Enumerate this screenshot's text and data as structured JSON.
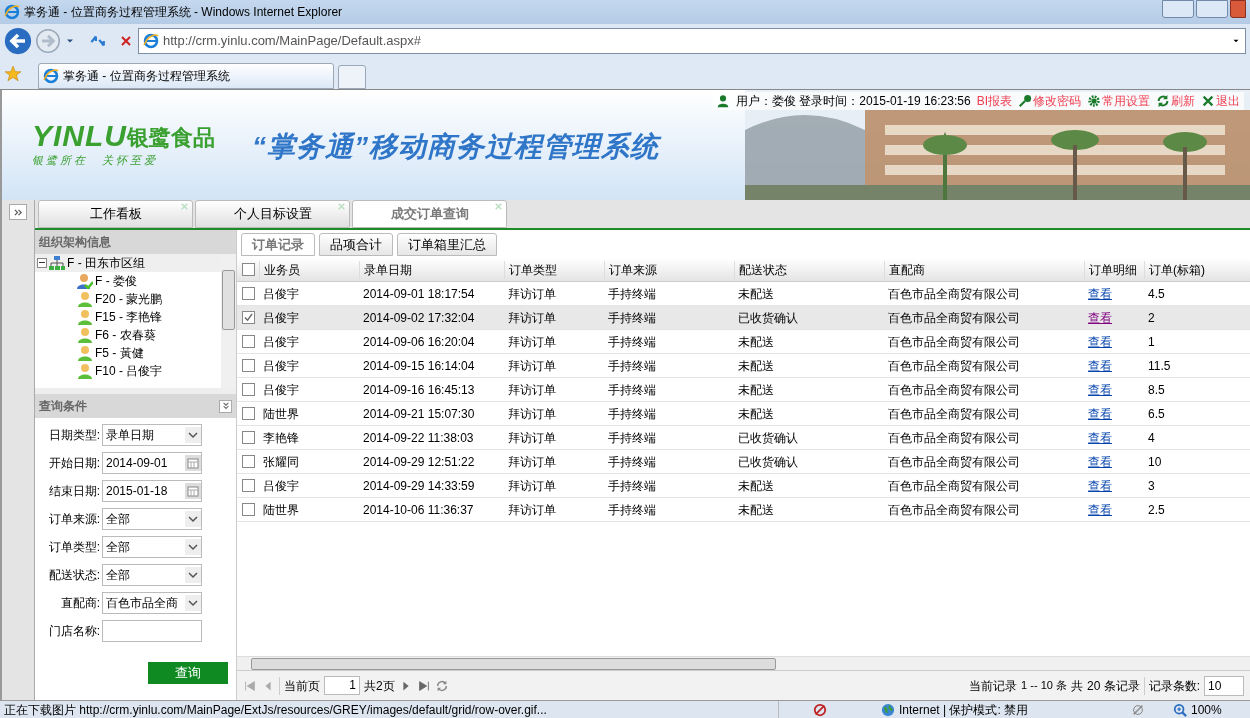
{
  "window": {
    "title": "掌务通 - 位置商务过程管理系统 - Windows Internet Explorer"
  },
  "address": {
    "url": "http://crm.yinlu.com/MainPage/Default.aspx#"
  },
  "browser_tabs": [
    {
      "label": "掌务通 - 位置商务过程管理系统",
      "selected": true
    }
  ],
  "header": {
    "user": "用户：娄俊 登录时间：2015-01-19 16:23:56",
    "links": [
      {
        "label": "BI报表",
        "kind": "none"
      },
      {
        "label": "修改密码",
        "kind": "key"
      },
      {
        "label": "常用设置",
        "kind": "gear"
      },
      {
        "label": "刷新",
        "kind": "refresh"
      },
      {
        "label": "退出",
        "kind": "close"
      }
    ],
    "logo": "YINLU",
    "brand": "银鹭食品",
    "slogan": "银 鹭 所 在 　 关 怀 至 爱",
    "system_title": "“掌务通”移动商务过程管理系统"
  },
  "tabs": [
    {
      "label": "工作看板",
      "selected": false
    },
    {
      "label": "个人目标设置",
      "selected": false
    },
    {
      "label": "成交订单查询",
      "selected": true
    }
  ],
  "org_panel": {
    "title": "组织架构信息",
    "tree": [
      {
        "label": "F - 田东市区组",
        "kind": "group",
        "expanded": true,
        "children": [
          {
            "label": "F - 娄俊",
            "kind": "manager"
          },
          {
            "label": "F20 - 蒙光鹏",
            "kind": "person"
          },
          {
            "label": "F15 - 李艳锋",
            "kind": "person"
          },
          {
            "label": "F6 - 农春葵",
            "kind": "person"
          },
          {
            "label": "F5 - 黃健",
            "kind": "person"
          },
          {
            "label": "F10 - 吕俊宇",
            "kind": "person"
          }
        ]
      }
    ]
  },
  "query_panel": {
    "title": "查询条件",
    "fields": [
      {
        "label": "日期类型:",
        "value": "录单日期",
        "kind": "select"
      },
      {
        "label": "开始日期:",
        "value": "2014-09-01",
        "kind": "date"
      },
      {
        "label": "结束日期:",
        "value": "2015-01-18",
        "kind": "date"
      },
      {
        "label": "订单来源:",
        "value": "全部",
        "kind": "select"
      },
      {
        "label": "订单类型:",
        "value": "全部",
        "kind": "select"
      },
      {
        "label": "配送状态:",
        "value": "全部",
        "kind": "select"
      },
      {
        "label": "直配商:",
        "value": "百色市品全商",
        "kind": "select"
      },
      {
        "label": "门店名称:",
        "kind": "text"
      }
    ],
    "button": "查询"
  },
  "sub_tabs": [
    {
      "label": "订单记录",
      "selected": true
    },
    {
      "label": "品项合计",
      "selected": false
    },
    {
      "label": "订单箱里汇总",
      "selected": false
    }
  ],
  "table": {
    "all_checked": false,
    "columns": [
      "业务员",
      "录单日期",
      "订单类型",
      "订单来源",
      "配送状态",
      "直配商",
      "订单明细",
      "订单(标箱)"
    ],
    "rows": [
      {
        "checked": false,
        "visited": false,
        "cells": [
          "吕俊宇",
          "2014-09-01 18:17:54",
          "拜访订单",
          "手持终端",
          "未配送",
          "百色市品全商贸有限公司",
          "查看",
          "4.5"
        ]
      },
      {
        "checked": true,
        "visited": true,
        "cells": [
          "吕俊宇",
          "2014-09-02 17:32:04",
          "拜访订单",
          "手持终端",
          "已收货确认",
          "百色市品全商贸有限公司",
          "查看",
          "2"
        ]
      },
      {
        "checked": false,
        "visited": false,
        "cells": [
          "吕俊宇",
          "2014-09-06 16:20:04",
          "拜访订单",
          "手持终端",
          "未配送",
          "百色市品全商贸有限公司",
          "查看",
          "1"
        ]
      },
      {
        "checked": false,
        "visited": false,
        "cells": [
          "吕俊宇",
          "2014-09-15 16:14:04",
          "拜访订单",
          "手持终端",
          "未配送",
          "百色市品全商贸有限公司",
          "查看",
          "11.5"
        ]
      },
      {
        "checked": false,
        "visited": false,
        "cells": [
          "吕俊宇",
          "2014-09-16 16:45:13",
          "拜访订单",
          "手持终端",
          "未配送",
          "百色市品全商贸有限公司",
          "查看",
          "8.5"
        ]
      },
      {
        "checked": false,
        "visited": false,
        "cells": [
          "陆世界",
          "2014-09-21 15:07:30",
          "拜访订单",
          "手持终端",
          "未配送",
          "百色市品全商贸有限公司",
          "查看",
          "6.5"
        ]
      },
      {
        "checked": false,
        "visited": false,
        "cells": [
          "李艳锋",
          "2014-09-22 11:38:03",
          "拜访订单",
          "手持终端",
          "已收货确认",
          "百色市品全商贸有限公司",
          "查看",
          "4"
        ]
      },
      {
        "checked": false,
        "visited": false,
        "cells": [
          "张耀同",
          "2014-09-29 12:51:22",
          "拜访订单",
          "手持终端",
          "已收货确认",
          "百色市品全商贸有限公司",
          "查看",
          "10"
        ]
      },
      {
        "checked": false,
        "visited": false,
        "cells": [
          "吕俊宇",
          "2014-09-29 14:33:59",
          "拜访订单",
          "手持终端",
          "未配送",
          "百色市品全商贸有限公司",
          "查看",
          "3"
        ]
      },
      {
        "checked": false,
        "visited": false,
        "cells": [
          "陆世界",
          "2014-10-06 11:36:37",
          "拜访订单",
          "手持终端",
          "未配送",
          "百色市品全商贸有限公司",
          "查看",
          "2.5"
        ]
      }
    ]
  },
  "paging": {
    "page_label": "当前页",
    "page": "1",
    "total_pages": "共2页",
    "record_label": "当前记录",
    "range": "1 -- 10 条",
    "total_label": "共",
    "total": "20 条记录",
    "size_label": "记录条数:",
    "size": "10"
  },
  "status_bar": {
    "text": "正在下载图片 http://crm.yinlu.com/MainPage/ExtJs/resources/GREY/images/default/grid/row-over.gif...",
    "zone": "Internet | 保护模式: 禁用",
    "zoom": "100%"
  }
}
